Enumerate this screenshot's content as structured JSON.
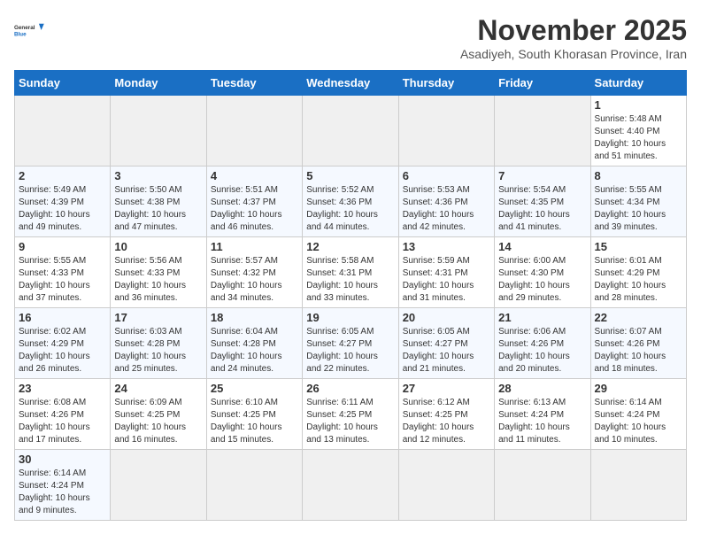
{
  "header": {
    "logo_general": "General",
    "logo_blue": "Blue",
    "month_title": "November 2025",
    "subtitle": "Asadiyeh, South Khorasan Province, Iran"
  },
  "days_of_week": [
    "Sunday",
    "Monday",
    "Tuesday",
    "Wednesday",
    "Thursday",
    "Friday",
    "Saturday"
  ],
  "weeks": [
    [
      {
        "day": "",
        "info": ""
      },
      {
        "day": "",
        "info": ""
      },
      {
        "day": "",
        "info": ""
      },
      {
        "day": "",
        "info": ""
      },
      {
        "day": "",
        "info": ""
      },
      {
        "day": "",
        "info": ""
      },
      {
        "day": "1",
        "info": "Sunrise: 5:48 AM\nSunset: 4:40 PM\nDaylight: 10 hours and 51 minutes."
      }
    ],
    [
      {
        "day": "2",
        "info": "Sunrise: 5:49 AM\nSunset: 4:39 PM\nDaylight: 10 hours and 49 minutes."
      },
      {
        "day": "3",
        "info": "Sunrise: 5:50 AM\nSunset: 4:38 PM\nDaylight: 10 hours and 47 minutes."
      },
      {
        "day": "4",
        "info": "Sunrise: 5:51 AM\nSunset: 4:37 PM\nDaylight: 10 hours and 46 minutes."
      },
      {
        "day": "5",
        "info": "Sunrise: 5:52 AM\nSunset: 4:36 PM\nDaylight: 10 hours and 44 minutes."
      },
      {
        "day": "6",
        "info": "Sunrise: 5:53 AM\nSunset: 4:36 PM\nDaylight: 10 hours and 42 minutes."
      },
      {
        "day": "7",
        "info": "Sunrise: 5:54 AM\nSunset: 4:35 PM\nDaylight: 10 hours and 41 minutes."
      },
      {
        "day": "8",
        "info": "Sunrise: 5:55 AM\nSunset: 4:34 PM\nDaylight: 10 hours and 39 minutes."
      }
    ],
    [
      {
        "day": "9",
        "info": "Sunrise: 5:55 AM\nSunset: 4:33 PM\nDaylight: 10 hours and 37 minutes."
      },
      {
        "day": "10",
        "info": "Sunrise: 5:56 AM\nSunset: 4:33 PM\nDaylight: 10 hours and 36 minutes."
      },
      {
        "day": "11",
        "info": "Sunrise: 5:57 AM\nSunset: 4:32 PM\nDaylight: 10 hours and 34 minutes."
      },
      {
        "day": "12",
        "info": "Sunrise: 5:58 AM\nSunset: 4:31 PM\nDaylight: 10 hours and 33 minutes."
      },
      {
        "day": "13",
        "info": "Sunrise: 5:59 AM\nSunset: 4:31 PM\nDaylight: 10 hours and 31 minutes."
      },
      {
        "day": "14",
        "info": "Sunrise: 6:00 AM\nSunset: 4:30 PM\nDaylight: 10 hours and 29 minutes."
      },
      {
        "day": "15",
        "info": "Sunrise: 6:01 AM\nSunset: 4:29 PM\nDaylight: 10 hours and 28 minutes."
      }
    ],
    [
      {
        "day": "16",
        "info": "Sunrise: 6:02 AM\nSunset: 4:29 PM\nDaylight: 10 hours and 26 minutes."
      },
      {
        "day": "17",
        "info": "Sunrise: 6:03 AM\nSunset: 4:28 PM\nDaylight: 10 hours and 25 minutes."
      },
      {
        "day": "18",
        "info": "Sunrise: 6:04 AM\nSunset: 4:28 PM\nDaylight: 10 hours and 24 minutes."
      },
      {
        "day": "19",
        "info": "Sunrise: 6:05 AM\nSunset: 4:27 PM\nDaylight: 10 hours and 22 minutes."
      },
      {
        "day": "20",
        "info": "Sunrise: 6:05 AM\nSunset: 4:27 PM\nDaylight: 10 hours and 21 minutes."
      },
      {
        "day": "21",
        "info": "Sunrise: 6:06 AM\nSunset: 4:26 PM\nDaylight: 10 hours and 20 minutes."
      },
      {
        "day": "22",
        "info": "Sunrise: 6:07 AM\nSunset: 4:26 PM\nDaylight: 10 hours and 18 minutes."
      }
    ],
    [
      {
        "day": "23",
        "info": "Sunrise: 6:08 AM\nSunset: 4:26 PM\nDaylight: 10 hours and 17 minutes."
      },
      {
        "day": "24",
        "info": "Sunrise: 6:09 AM\nSunset: 4:25 PM\nDaylight: 10 hours and 16 minutes."
      },
      {
        "day": "25",
        "info": "Sunrise: 6:10 AM\nSunset: 4:25 PM\nDaylight: 10 hours and 15 minutes."
      },
      {
        "day": "26",
        "info": "Sunrise: 6:11 AM\nSunset: 4:25 PM\nDaylight: 10 hours and 13 minutes."
      },
      {
        "day": "27",
        "info": "Sunrise: 6:12 AM\nSunset: 4:25 PM\nDaylight: 10 hours and 12 minutes."
      },
      {
        "day": "28",
        "info": "Sunrise: 6:13 AM\nSunset: 4:24 PM\nDaylight: 10 hours and 11 minutes."
      },
      {
        "day": "29",
        "info": "Sunrise: 6:14 AM\nSunset: 4:24 PM\nDaylight: 10 hours and 10 minutes."
      }
    ],
    [
      {
        "day": "30",
        "info": "Sunrise: 6:14 AM\nSunset: 4:24 PM\nDaylight: 10 hours and 9 minutes."
      },
      {
        "day": "",
        "info": ""
      },
      {
        "day": "",
        "info": ""
      },
      {
        "day": "",
        "info": ""
      },
      {
        "day": "",
        "info": ""
      },
      {
        "day": "",
        "info": ""
      },
      {
        "day": "",
        "info": ""
      }
    ]
  ]
}
